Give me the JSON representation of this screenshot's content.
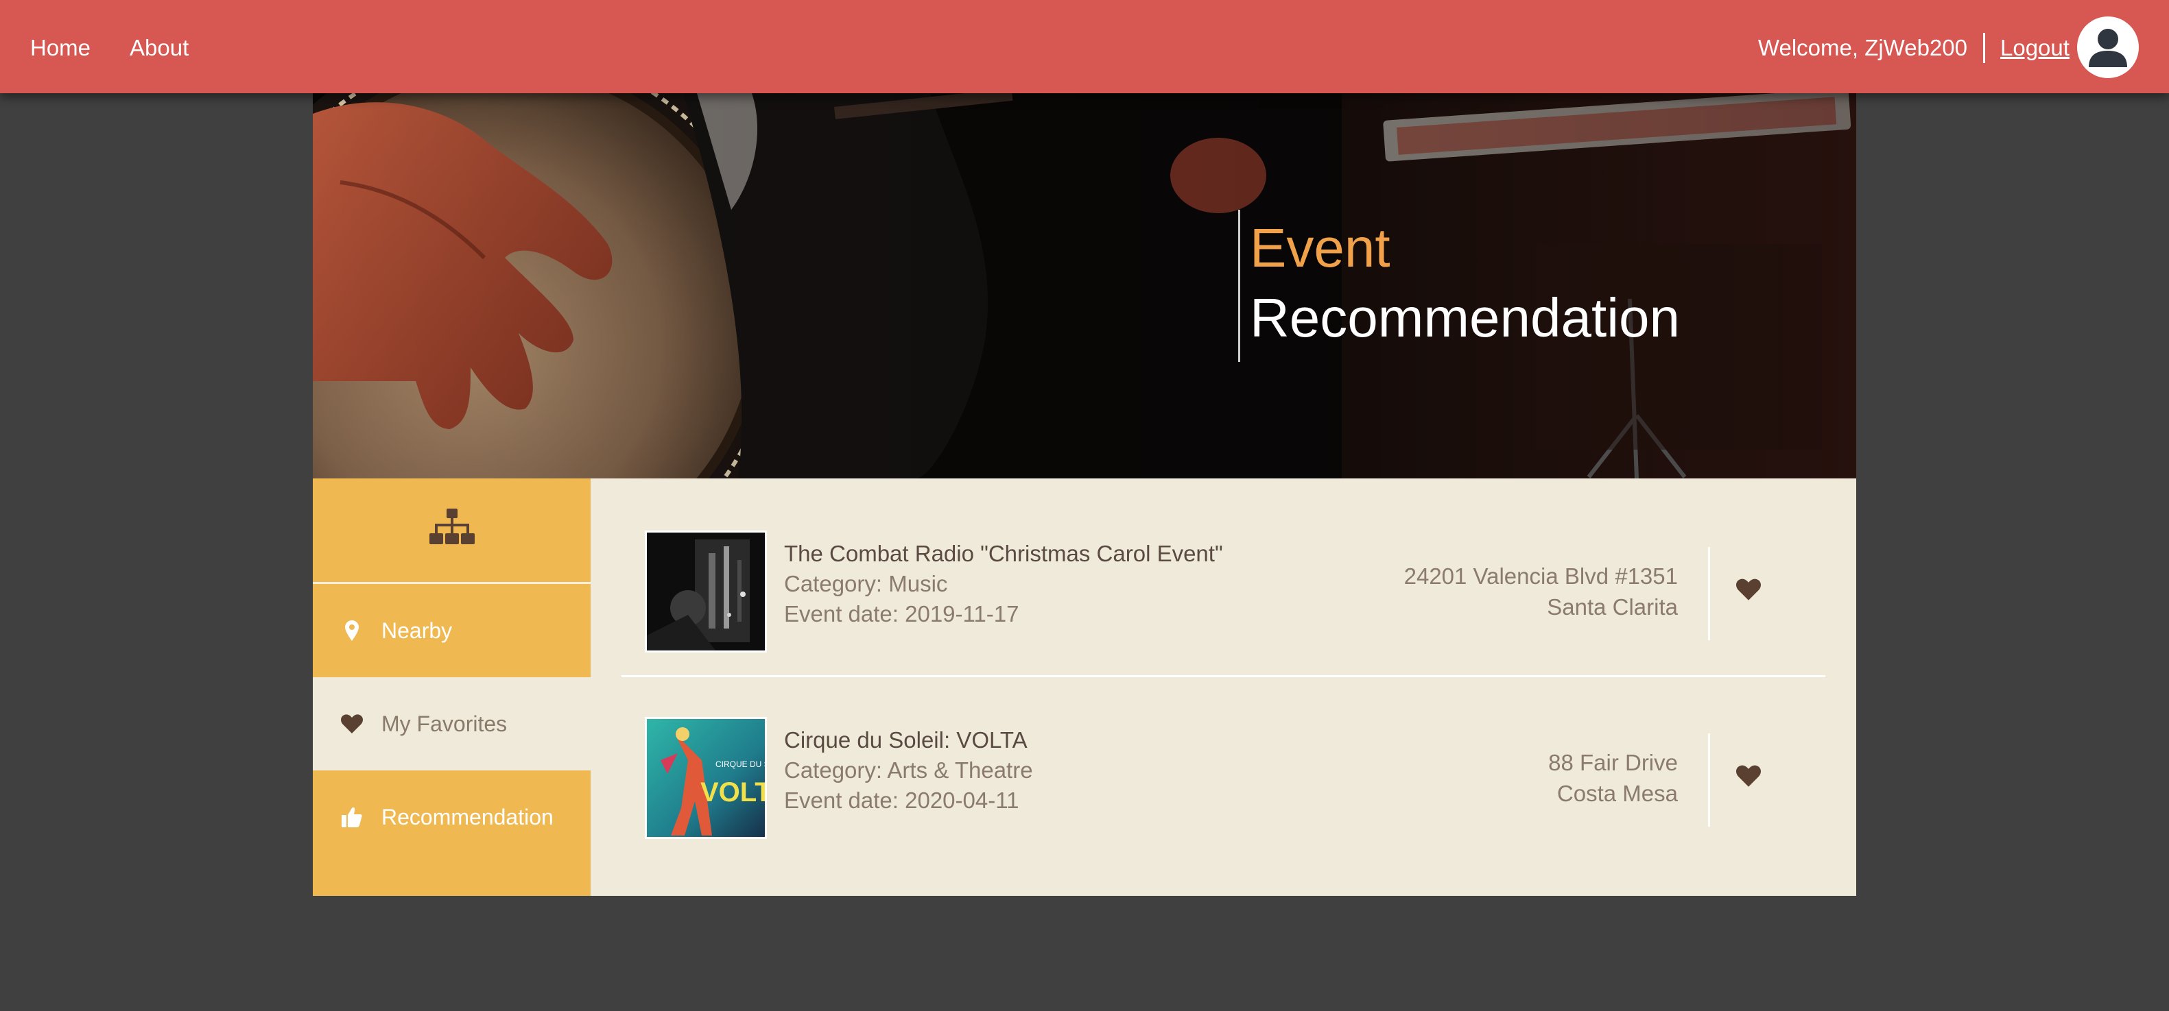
{
  "nav": {
    "home_label": "Home",
    "about_label": "About",
    "welcome_text": "Welcome, ZjWeb200",
    "logout_label": "Logout",
    "avatar_icon": "user-avatar-icon"
  },
  "hero": {
    "title_accent": "Event",
    "title_main": "Recommendation",
    "accent_color": "#f0a14a"
  },
  "sidebar": {
    "top_icon": "sitemap-icon",
    "items": [
      {
        "label": "Nearby",
        "icon": "map-marker-icon",
        "active": false
      },
      {
        "label": "My Favorites",
        "icon": "heart-icon",
        "active": true
      },
      {
        "label": "Recommendation",
        "icon": "thumbs-up-icon",
        "active": false
      }
    ]
  },
  "events": [
    {
      "name": "The Combat Radio \"Christmas Carol Event\"",
      "category": "Category: Music",
      "date": "Event date: 2019-11-17",
      "address_line1": "24201 Valencia Blvd #1351",
      "address_line2": "Santa Clarita",
      "favorite": true
    },
    {
      "name": "Cirque du Soleil: VOLTA",
      "category": "Category: Arts & Theatre",
      "date": "Event date: 2020-04-11",
      "address_line1": "88 Fair Drive",
      "address_line2": "Costa Mesa",
      "favorite": true
    }
  ],
  "colors": {
    "nav_bg": "#d75752",
    "page_bg": "#404040",
    "sidebar_bg": "#f0b850",
    "content_bg": "#efeada",
    "heart": "#5a4030"
  }
}
